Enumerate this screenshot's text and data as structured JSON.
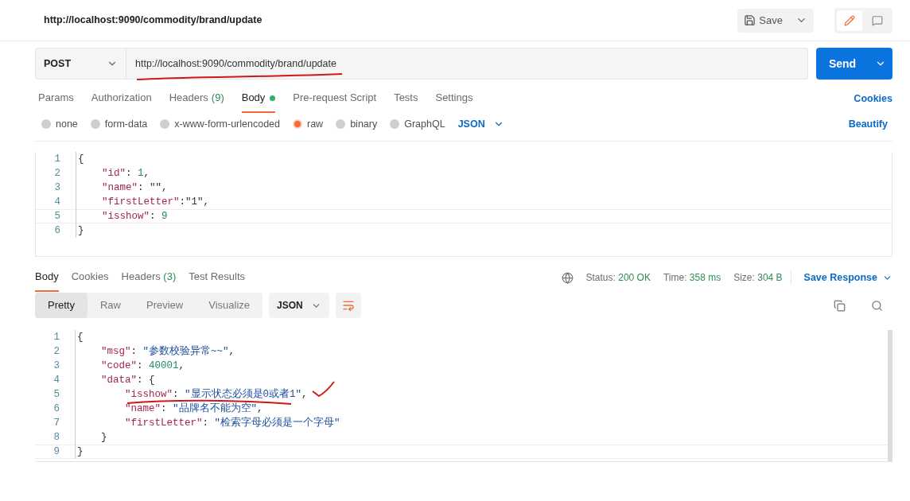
{
  "title": "http://localhost:9090/commodity/brand/update",
  "save_button": "Save",
  "request": {
    "method": "POST",
    "url": "http://localhost:9090/commodity/brand/update",
    "send": "Send"
  },
  "request_tabs": [
    {
      "label": "Params",
      "selected": false,
      "has_content": false
    },
    {
      "label": "Authorization",
      "selected": false,
      "has_content": false
    },
    {
      "label": "Headers",
      "count": "(9)",
      "selected": false,
      "has_content": false
    },
    {
      "label": "Body",
      "selected": true,
      "has_content": true
    },
    {
      "label": "Pre-request Script",
      "selected": false,
      "has_content": false
    },
    {
      "label": "Tests",
      "selected": false,
      "has_content": false
    },
    {
      "label": "Settings",
      "selected": false,
      "has_content": false
    }
  ],
  "cookies_link": "Cookies",
  "body_types": [
    {
      "label": "none",
      "selected": false
    },
    {
      "label": "form-data",
      "selected": false
    },
    {
      "label": "x-www-form-urlencoded",
      "selected": false
    },
    {
      "label": "raw",
      "selected": true
    },
    {
      "label": "binary",
      "selected": false
    },
    {
      "label": "GraphQL",
      "selected": false
    }
  ],
  "body_format": "JSON",
  "beautify": "Beautify",
  "request_body": [
    {
      "number": "1",
      "tokens": [
        {
          "kind": "p",
          "text": "{"
        }
      ]
    },
    {
      "number": "2",
      "tokens": [
        {
          "kind": "k",
          "text": "    \"id\""
        },
        {
          "kind": "p",
          "text": ": "
        },
        {
          "kind": "n",
          "text": "1"
        },
        {
          "kind": "p",
          "text": ","
        }
      ]
    },
    {
      "number": "3",
      "tokens": [
        {
          "kind": "k",
          "text": "    \"name\""
        },
        {
          "kind": "p",
          "text": ": \"\","
        }
      ]
    },
    {
      "number": "4",
      "tokens": [
        {
          "kind": "k",
          "text": "    \"firstLetter\""
        },
        {
          "kind": "p",
          "text": ":\"1\","
        }
      ]
    },
    {
      "number": "5",
      "tokens": [
        {
          "kind": "k",
          "text": "    \"isshow\""
        },
        {
          "kind": "p",
          "text": ": "
        },
        {
          "kind": "n",
          "text": "9"
        }
      ]
    },
    {
      "number": "6",
      "tokens": [
        {
          "kind": "p",
          "text": "}"
        }
      ]
    }
  ],
  "response": {
    "tabs": [
      {
        "label": "Body",
        "selected": true
      },
      {
        "label": "Cookies",
        "selected": false
      },
      {
        "label": "Headers",
        "count": "(3)",
        "selected": false
      },
      {
        "label": "Test Results",
        "selected": false
      }
    ],
    "status_label": "Status:",
    "status": "200 OK",
    "time_label": "Time:",
    "time": "358 ms",
    "size_label": "Size:",
    "size": "304 B",
    "save_response": "Save Response",
    "view_tabs": [
      {
        "label": "Pretty",
        "selected": true
      },
      {
        "label": "Raw",
        "selected": false
      },
      {
        "label": "Preview",
        "selected": false
      },
      {
        "label": "Visualize",
        "selected": false
      }
    ],
    "format": "JSON",
    "lines": [
      {
        "number": "1",
        "tokens": [
          {
            "kind": "p",
            "text": "{"
          }
        ]
      },
      {
        "number": "2",
        "tokens": [
          {
            "kind": "k",
            "text": "    \"msg\""
          },
          {
            "kind": "p",
            "text": ": "
          },
          {
            "kind": "s",
            "text": "\"参数校验异常~~\""
          },
          {
            "kind": "p",
            "text": ","
          }
        ]
      },
      {
        "number": "3",
        "tokens": [
          {
            "kind": "k",
            "text": "    \"code\""
          },
          {
            "kind": "p",
            "text": ": "
          },
          {
            "kind": "n",
            "text": "40001"
          },
          {
            "kind": "p",
            "text": ","
          }
        ]
      },
      {
        "number": "4",
        "tokens": [
          {
            "kind": "k",
            "text": "    \"data\""
          },
          {
            "kind": "p",
            "text": ": {"
          }
        ]
      },
      {
        "number": "5",
        "tokens": [
          {
            "kind": "k",
            "text": "        \"isshow\""
          },
          {
            "kind": "p",
            "text": ": "
          },
          {
            "kind": "s",
            "text": "\"显示状态必须是0或者1\""
          },
          {
            "kind": "p",
            "text": ","
          }
        ]
      },
      {
        "number": "6",
        "tokens": [
          {
            "kind": "k",
            "text": "        \"name\""
          },
          {
            "kind": "p",
            "text": ": "
          },
          {
            "kind": "s",
            "text": "\"品牌名不能为空\""
          },
          {
            "kind": "p",
            "text": ","
          }
        ]
      },
      {
        "number": "7",
        "tokens": [
          {
            "kind": "k",
            "text": "        \"firstLetter\""
          },
          {
            "kind": "p",
            "text": ": "
          },
          {
            "kind": "s",
            "text": "\"检索字母必须是一个字母\""
          }
        ]
      },
      {
        "number": "8",
        "tokens": [
          {
            "kind": "p",
            "text": "    }"
          }
        ]
      },
      {
        "number": "9",
        "tokens": [
          {
            "kind": "p",
            "text": "}"
          }
        ]
      }
    ]
  }
}
